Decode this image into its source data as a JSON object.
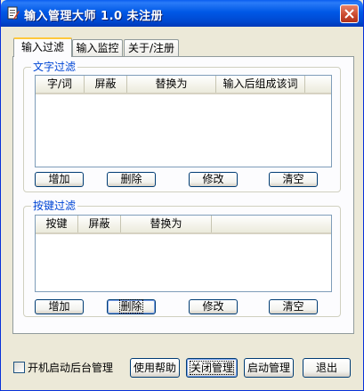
{
  "window": {
    "title": "输入管理大师 1.0 未注册"
  },
  "tabs": [
    {
      "label": "输入过滤",
      "active": true
    },
    {
      "label": "输入监控",
      "active": false
    },
    {
      "label": "关于/注册",
      "active": false
    }
  ],
  "text_filter": {
    "title": "文字过滤",
    "columns": [
      "字/词",
      "屏蔽",
      "替换为",
      "输入后组成该词"
    ],
    "rows": [],
    "buttons": {
      "add": "增加",
      "delete": "删除",
      "edit": "修改",
      "clear": "清空"
    }
  },
  "key_filter": {
    "title": "按键过滤",
    "columns": [
      "按键",
      "屏蔽",
      "替换为"
    ],
    "rows": [],
    "buttons": {
      "add": "增加",
      "delete": "删除",
      "edit": "修改",
      "clear": "清空"
    }
  },
  "bottom": {
    "startup_checkbox": {
      "label": "开机启动后台管理",
      "checked": false
    },
    "help_button": "使用帮助",
    "stop_button": "关闭管理",
    "start_button": "启动管理",
    "exit_button": "退出"
  },
  "icons": {
    "app": "notepad-icon",
    "close": "close-icon"
  },
  "colors": {
    "titlebar": "#0058e6",
    "group_title": "#0046d5",
    "tab_highlight": "#ffc83c"
  }
}
